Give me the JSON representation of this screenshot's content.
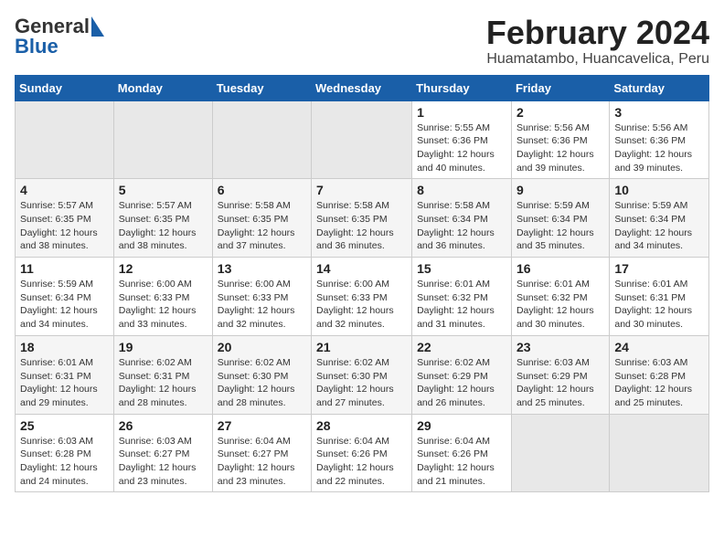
{
  "logo": {
    "general": "General",
    "blue": "Blue"
  },
  "title": "February 2024",
  "subtitle": "Huamatambo, Huancavelica, Peru",
  "days_of_week": [
    "Sunday",
    "Monday",
    "Tuesday",
    "Wednesday",
    "Thursday",
    "Friday",
    "Saturday"
  ],
  "weeks": [
    [
      {
        "day": "",
        "info": ""
      },
      {
        "day": "",
        "info": ""
      },
      {
        "day": "",
        "info": ""
      },
      {
        "day": "",
        "info": ""
      },
      {
        "day": "1",
        "info": "Sunrise: 5:55 AM\nSunset: 6:36 PM\nDaylight: 12 hours and 40 minutes."
      },
      {
        "day": "2",
        "info": "Sunrise: 5:56 AM\nSunset: 6:36 PM\nDaylight: 12 hours and 39 minutes."
      },
      {
        "day": "3",
        "info": "Sunrise: 5:56 AM\nSunset: 6:36 PM\nDaylight: 12 hours and 39 minutes."
      }
    ],
    [
      {
        "day": "4",
        "info": "Sunrise: 5:57 AM\nSunset: 6:35 PM\nDaylight: 12 hours and 38 minutes."
      },
      {
        "day": "5",
        "info": "Sunrise: 5:57 AM\nSunset: 6:35 PM\nDaylight: 12 hours and 38 minutes."
      },
      {
        "day": "6",
        "info": "Sunrise: 5:58 AM\nSunset: 6:35 PM\nDaylight: 12 hours and 37 minutes."
      },
      {
        "day": "7",
        "info": "Sunrise: 5:58 AM\nSunset: 6:35 PM\nDaylight: 12 hours and 36 minutes."
      },
      {
        "day": "8",
        "info": "Sunrise: 5:58 AM\nSunset: 6:34 PM\nDaylight: 12 hours and 36 minutes."
      },
      {
        "day": "9",
        "info": "Sunrise: 5:59 AM\nSunset: 6:34 PM\nDaylight: 12 hours and 35 minutes."
      },
      {
        "day": "10",
        "info": "Sunrise: 5:59 AM\nSunset: 6:34 PM\nDaylight: 12 hours and 34 minutes."
      }
    ],
    [
      {
        "day": "11",
        "info": "Sunrise: 5:59 AM\nSunset: 6:34 PM\nDaylight: 12 hours and 34 minutes."
      },
      {
        "day": "12",
        "info": "Sunrise: 6:00 AM\nSunset: 6:33 PM\nDaylight: 12 hours and 33 minutes."
      },
      {
        "day": "13",
        "info": "Sunrise: 6:00 AM\nSunset: 6:33 PM\nDaylight: 12 hours and 32 minutes."
      },
      {
        "day": "14",
        "info": "Sunrise: 6:00 AM\nSunset: 6:33 PM\nDaylight: 12 hours and 32 minutes."
      },
      {
        "day": "15",
        "info": "Sunrise: 6:01 AM\nSunset: 6:32 PM\nDaylight: 12 hours and 31 minutes."
      },
      {
        "day": "16",
        "info": "Sunrise: 6:01 AM\nSunset: 6:32 PM\nDaylight: 12 hours and 30 minutes."
      },
      {
        "day": "17",
        "info": "Sunrise: 6:01 AM\nSunset: 6:31 PM\nDaylight: 12 hours and 30 minutes."
      }
    ],
    [
      {
        "day": "18",
        "info": "Sunrise: 6:01 AM\nSunset: 6:31 PM\nDaylight: 12 hours and 29 minutes."
      },
      {
        "day": "19",
        "info": "Sunrise: 6:02 AM\nSunset: 6:31 PM\nDaylight: 12 hours and 28 minutes."
      },
      {
        "day": "20",
        "info": "Sunrise: 6:02 AM\nSunset: 6:30 PM\nDaylight: 12 hours and 28 minutes."
      },
      {
        "day": "21",
        "info": "Sunrise: 6:02 AM\nSunset: 6:30 PM\nDaylight: 12 hours and 27 minutes."
      },
      {
        "day": "22",
        "info": "Sunrise: 6:02 AM\nSunset: 6:29 PM\nDaylight: 12 hours and 26 minutes."
      },
      {
        "day": "23",
        "info": "Sunrise: 6:03 AM\nSunset: 6:29 PM\nDaylight: 12 hours and 25 minutes."
      },
      {
        "day": "24",
        "info": "Sunrise: 6:03 AM\nSunset: 6:28 PM\nDaylight: 12 hours and 25 minutes."
      }
    ],
    [
      {
        "day": "25",
        "info": "Sunrise: 6:03 AM\nSunset: 6:28 PM\nDaylight: 12 hours and 24 minutes."
      },
      {
        "day": "26",
        "info": "Sunrise: 6:03 AM\nSunset: 6:27 PM\nDaylight: 12 hours and 23 minutes."
      },
      {
        "day": "27",
        "info": "Sunrise: 6:04 AM\nSunset: 6:27 PM\nDaylight: 12 hours and 23 minutes."
      },
      {
        "day": "28",
        "info": "Sunrise: 6:04 AM\nSunset: 6:26 PM\nDaylight: 12 hours and 22 minutes."
      },
      {
        "day": "29",
        "info": "Sunrise: 6:04 AM\nSunset: 6:26 PM\nDaylight: 12 hours and 21 minutes."
      },
      {
        "day": "",
        "info": ""
      },
      {
        "day": "",
        "info": ""
      }
    ]
  ]
}
